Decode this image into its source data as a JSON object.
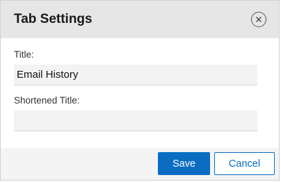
{
  "dialog": {
    "title": "Tab Settings",
    "close_icon": "close-circle-icon"
  },
  "fields": {
    "title": {
      "label": "Title:",
      "value": "Email History"
    },
    "shortened_title": {
      "label": "Shortened Title:",
      "value": ""
    }
  },
  "buttons": {
    "save": "Save",
    "cancel": "Cancel"
  },
  "colors": {
    "accent": "#0a6dc2",
    "header_bg": "#e6e6e6"
  }
}
